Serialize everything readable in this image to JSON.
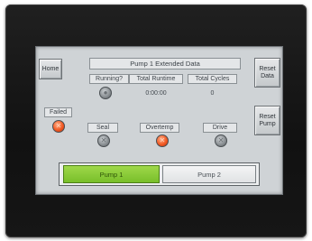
{
  "nav": {
    "home_label": "Home"
  },
  "header": {
    "title": "Pump 1 Extended Data"
  },
  "buttons": {
    "reset_data": "Reset\nData",
    "reset_pump": "Reset\nPump"
  },
  "columns": {
    "running": "Running?",
    "total_runtime": "Total Runtime",
    "total_cycles": "Total Cycles"
  },
  "values": {
    "total_runtime": "0:00:00",
    "total_cycles": "0"
  },
  "alarms": {
    "failed": "Failed",
    "seal": "Seal",
    "overtemp": "Overtemp",
    "drive": "Drive"
  },
  "tabs": [
    {
      "label": "Pump 1",
      "active": true
    },
    {
      "label": "Pump 2",
      "active": false
    }
  ],
  "colors": {
    "active_tab": "#8ccd3a",
    "alarm_active": "#f25a24",
    "indicator_off": "#8d9296"
  }
}
